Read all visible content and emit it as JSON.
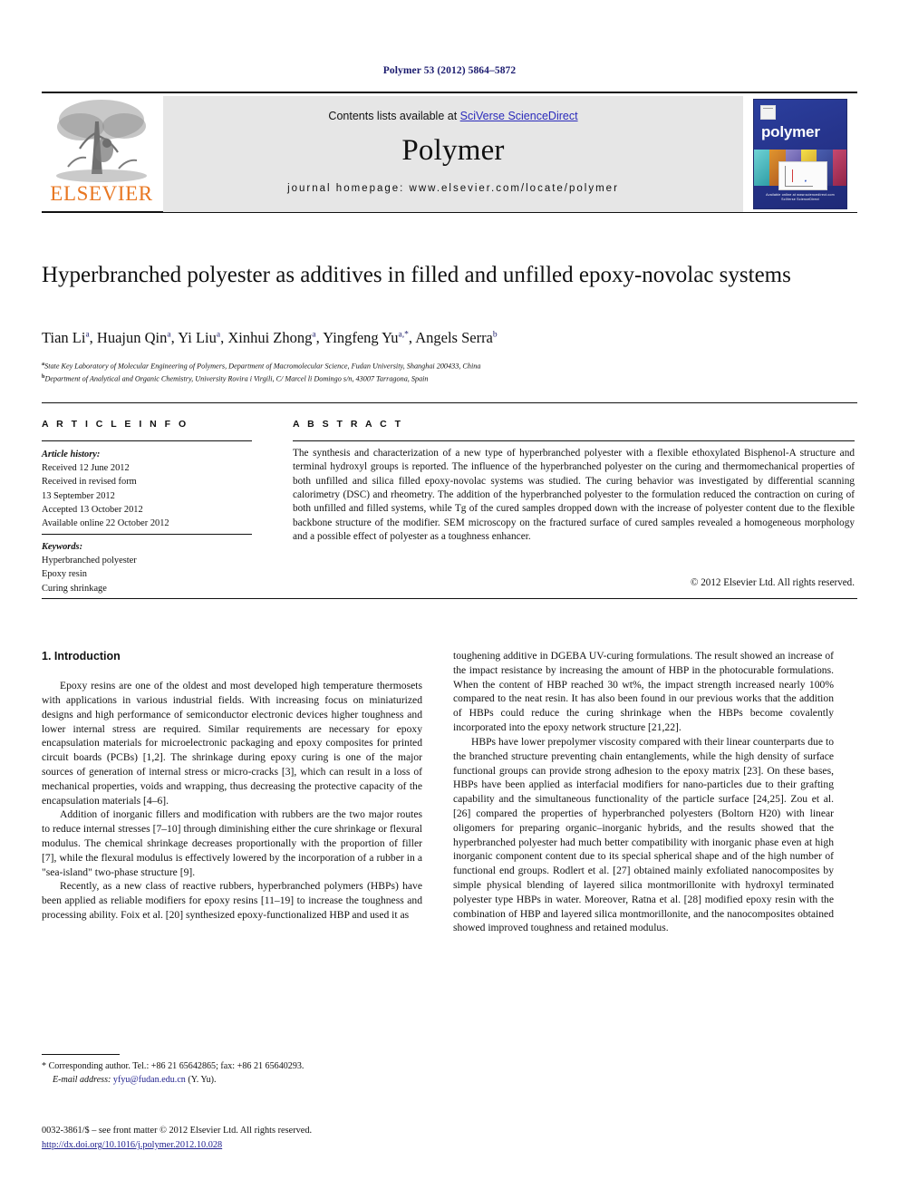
{
  "running_head": "Polymer 53 (2012) 5864–5872",
  "banner": {
    "publisher_name": "ELSEVIER",
    "contents_prefix": "Contents lists available at ",
    "contents_link": "SciVerse ScienceDirect",
    "journal_name": "Polymer",
    "homepage": "journal homepage: www.elsevier.com/locate/polymer",
    "cover": {
      "title": "polymer",
      "footer_line1": "Available online at www.sciencedirect.com",
      "footer_line2": "SciVerse ScienceDirect"
    }
  },
  "article": {
    "title": "Hyperbranched polyester as additives in filled and unfilled epoxy-novolac systems",
    "authors": [
      {
        "name": "Tian Li",
        "marks": "a"
      },
      {
        "name": "Huajun Qin",
        "marks": "a"
      },
      {
        "name": "Yi Liu",
        "marks": "a"
      },
      {
        "name": "Xinhui Zhong",
        "marks": "a"
      },
      {
        "name": "Yingfeng Yu",
        "marks": "a,*"
      },
      {
        "name": "Angels Serra",
        "marks": "b"
      }
    ],
    "authors_line": "Tian Li a, Huajun Qin a, Yi Liu a, Xinhui Zhong a, Yingfeng Yu a,*, Angels Serra b",
    "affiliations": [
      {
        "mark": "a",
        "text": "State Key Laboratory of Molecular Engineering of Polymers, Department of Macromolecular Science, Fudan University, Shanghai 200433, China"
      },
      {
        "mark": "b",
        "text": "Department of Analytical and Organic Chemistry, University Rovira i Virgili, C/ Marcel li Domingo s/n, 43007 Tarragona, Spain"
      }
    ]
  },
  "article_info": {
    "heading": "A R T I C L E   I N F O",
    "history_label": "Article history:",
    "history": [
      "Received 12 June 2012",
      "Received in revised form",
      "13 September 2012",
      "Accepted 13 October 2012",
      "Available online 22 October 2012"
    ],
    "keywords_label": "Keywords:",
    "keywords": [
      "Hyperbranched polyester",
      "Epoxy resin",
      "Curing shrinkage"
    ]
  },
  "abstract": {
    "heading": "A B S T R A C T",
    "text": "The synthesis and characterization of a new type of hyperbranched polyester with a flexible ethoxylated Bisphenol-A structure and terminal hydroxyl groups is reported. The influence of the hyperbranched polyester on the curing and thermomechanical properties of both unfilled and silica filled epoxy-novolac systems was studied. The curing behavior was investigated by differential scanning calorimetry (DSC) and rheometry. The addition of the hyperbranched polyester to the formulation reduced the contraction on curing of both unfilled and filled systems, while Tg of the cured samples dropped down with the increase of polyester content due to the flexible backbone structure of the modifier. SEM microscopy on the fractured surface of cured samples revealed a homogeneous morphology and a possible effect of polyester as a toughness enhancer.",
    "copyright": "© 2012 Elsevier Ltd. All rights reserved."
  },
  "body": {
    "section_heading": "1. Introduction",
    "left_paragraphs": [
      "Epoxy resins are one of the oldest and most developed high temperature thermosets with applications in various industrial fields. With increasing focus on miniaturized designs and high performance of semiconductor electronic devices higher toughness and lower internal stress are required. Similar requirements are necessary for epoxy encapsulation materials for microelectronic packaging and epoxy composites for printed circuit boards (PCBs) [1,2]. The shrinkage during epoxy curing is one of the major sources of generation of internal stress or micro-cracks [3], which can result in a loss of mechanical properties, voids and wrapping, thus decreasing the protective capacity of the encapsulation materials [4–6].",
      "Addition of inorganic fillers and modification with rubbers are the two major routes to reduce internal stresses [7–10] through diminishing either the cure shrinkage or flexural modulus. The chemical shrinkage decreases proportionally with the proportion of filler [7], while the flexural modulus is effectively lowered by the incorporation of a rubber in a \"sea-island\" two-phase structure [9].",
      "Recently, as a new class of reactive rubbers, hyperbranched polymers (HBPs) have been applied as reliable modifiers for epoxy resins [11–19] to increase the toughness and processing ability. Foix et al. [20] synthesized epoxy-functionalized HBP and used it as"
    ],
    "right_paragraphs": [
      "toughening additive in DGEBA UV-curing formulations. The result showed an increase of the impact resistance by increasing the amount of HBP in the photocurable formulations. When the content of HBP reached 30 wt%, the impact strength increased nearly 100% compared to the neat resin. It has also been found in our previous works that the addition of HBPs could reduce the curing shrinkage when the HBPs become covalently incorporated into the epoxy network structure [21,22].",
      "HBPs have lower prepolymer viscosity compared with their linear counterparts due to the branched structure preventing chain entanglements, while the high density of surface functional groups can provide strong adhesion to the epoxy matrix [23]. On these bases, HBPs have been applied as interfacial modifiers for nano-particles due to their grafting capability and the simultaneous functionality of the particle surface [24,25]. Zou et al. [26] compared the properties of hyperbranched polyesters (Boltorn H20) with linear oligomers for preparing organic–inorganic hybrids, and the results showed that the hyperbranched polyester had much better compatibility with inorganic phase even at high inorganic component content due to its special spherical shape and of the high number of functional end groups. Rodlert et al. [27] obtained mainly exfoliated nanocomposites by simple physical blending of layered silica montmorillonite with hydroxyl terminated polyester type HBPs in water. Moreover, Ratna et al. [28] modified epoxy resin with the combination of HBP and layered silica montmorillonite, and the nanocomposites obtained showed improved toughness and retained modulus."
    ]
  },
  "footnote": {
    "star": "*",
    "corresponding": "Corresponding author. Tel.: +86 21 65642865; fax: +86 21 65640293.",
    "email_label": "E-mail address:",
    "email": "yfyu@fudan.edu.cn",
    "email_suffix": "(Y. Yu)."
  },
  "bottom_meta": {
    "issn_line": "0032-3861/$ – see front matter © 2012 Elsevier Ltd. All rights reserved.",
    "doi": "http://dx.doi.org/10.1016/j.polymer.2012.10.028"
  },
  "colors": {
    "link_blue": "#22228e",
    "running_head_blue": "#1a1a6e",
    "elsevier_orange": "#E87722",
    "banner_grey": "#e6e6e6",
    "cover_blue": "#2b3f9e"
  }
}
